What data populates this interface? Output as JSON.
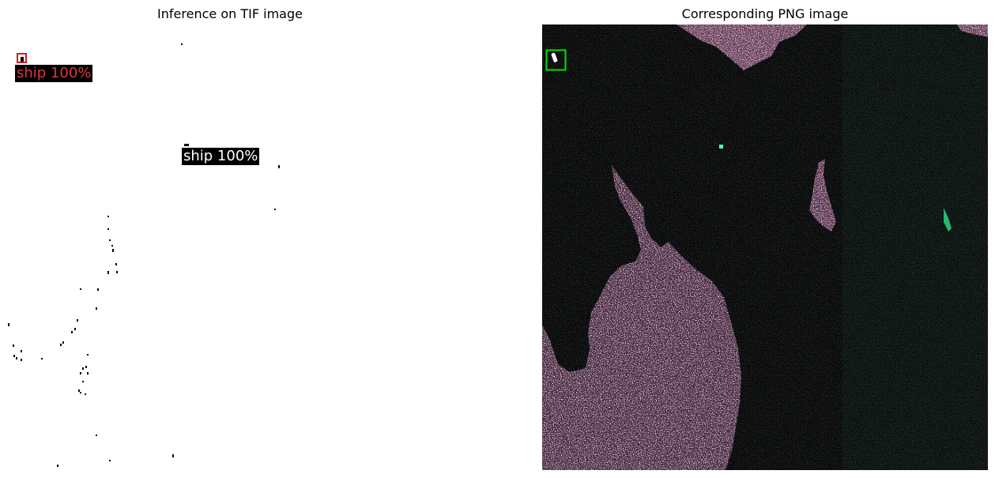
{
  "figure": {
    "left_title": "Inference on TIF image",
    "right_title": "Corresponding PNG image"
  },
  "detections": [
    {
      "label": "ship 100%",
      "color": "#d9393f"
    },
    {
      "label": "ship 100%",
      "color": "#ffffff"
    }
  ],
  "colors": {
    "left_box": "#c8202a",
    "right_box": "#00e000",
    "label_bg": "#000000",
    "sea": "#0a0608",
    "land_light": "#d8c8d0",
    "land_mid": "#8a5a78",
    "speckle_green": "#2fe08a"
  }
}
